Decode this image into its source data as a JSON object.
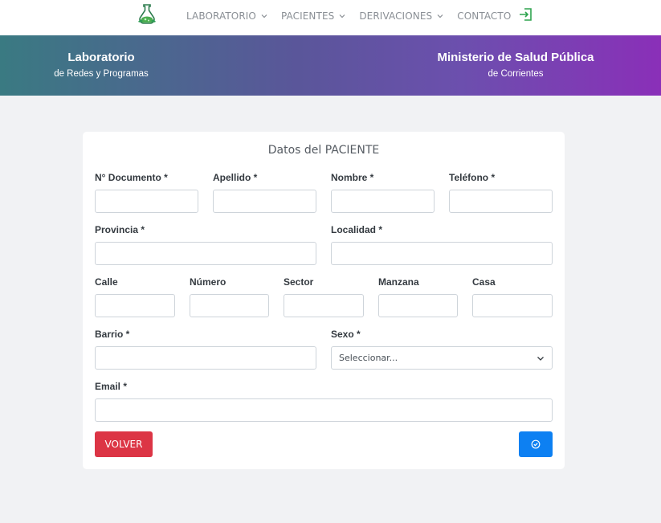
{
  "nav": {
    "items": [
      {
        "label": "LABORATORIO",
        "dropdown": true
      },
      {
        "label": "PACIENTES",
        "dropdown": true
      },
      {
        "label": "DERIVACIONES",
        "dropdown": true
      },
      {
        "label": "CONTACTO",
        "dropdown": false
      }
    ],
    "logo_icon": "flask-icon",
    "logout_icon": "logout-icon",
    "text_color": "#8a8f95"
  },
  "banner": {
    "left_title": "Laboratorio",
    "left_subtitle": "de Redes y Programas",
    "right_title": "Ministerio de Salud Pública",
    "right_subtitle": "de Corrientes",
    "gradient_start": "#3a7a82",
    "gradient_end": "#8a2fb8"
  },
  "form": {
    "title": "Datos del PACIENTE",
    "fields": {
      "documento": {
        "label": "N° Documento *",
        "value": ""
      },
      "apellido": {
        "label": "Apellido *",
        "value": ""
      },
      "nombre": {
        "label": "Nombre *",
        "value": ""
      },
      "telefono": {
        "label": "Teléfono *",
        "value": ""
      },
      "provincia": {
        "label": "Provincia *",
        "value": ""
      },
      "localidad": {
        "label": "Localidad *",
        "value": ""
      },
      "calle": {
        "label": "Calle",
        "value": ""
      },
      "numero": {
        "label": "Número",
        "value": ""
      },
      "sector": {
        "label": "Sector",
        "value": ""
      },
      "manzana": {
        "label": "Manzana",
        "value": ""
      },
      "casa": {
        "label": "Casa",
        "value": ""
      },
      "barrio": {
        "label": "Barrio *",
        "value": ""
      },
      "sexo": {
        "label": "Sexo *",
        "selected": "Seleccionar..."
      },
      "email": {
        "label": "Email *",
        "value": ""
      }
    },
    "back_button": "VOLVER",
    "submit_icon": "check-circle-icon",
    "back_color": "#dc3545",
    "submit_color": "#0d80f2"
  }
}
